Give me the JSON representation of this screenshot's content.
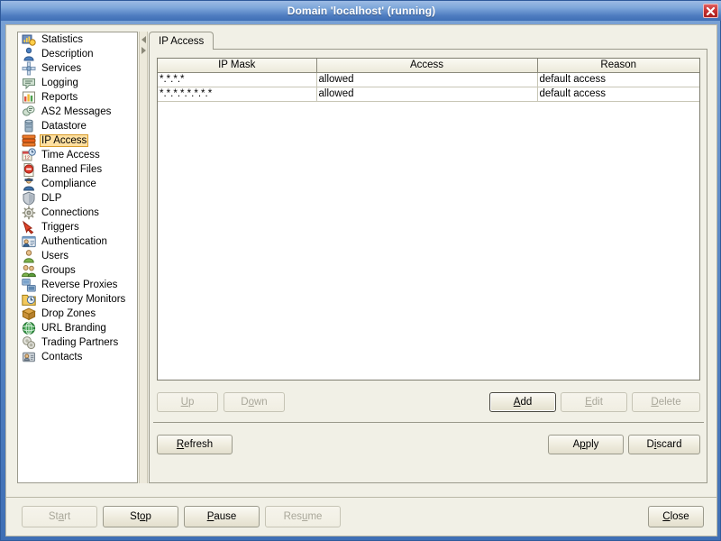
{
  "window": {
    "title": "Domain 'localhost' (running)",
    "close_icon": "close-icon"
  },
  "sidebar": {
    "items": [
      {
        "label": "Statistics",
        "icon": "statistics-icon",
        "selected": false
      },
      {
        "label": "Description",
        "icon": "description-icon",
        "selected": false
      },
      {
        "label": "Services",
        "icon": "services-icon",
        "selected": false
      },
      {
        "label": "Logging",
        "icon": "logging-icon",
        "selected": false
      },
      {
        "label": "Reports",
        "icon": "reports-icon",
        "selected": false
      },
      {
        "label": "AS2 Messages",
        "icon": "as2-messages-icon",
        "selected": false
      },
      {
        "label": "Datastore",
        "icon": "datastore-icon",
        "selected": false
      },
      {
        "label": "IP Access",
        "icon": "ip-access-icon",
        "selected": true
      },
      {
        "label": "Time Access",
        "icon": "time-access-icon",
        "selected": false
      },
      {
        "label": "Banned Files",
        "icon": "banned-files-icon",
        "selected": false
      },
      {
        "label": "Compliance",
        "icon": "compliance-icon",
        "selected": false
      },
      {
        "label": "DLP",
        "icon": "dlp-icon",
        "selected": false
      },
      {
        "label": "Connections",
        "icon": "connections-icon",
        "selected": false
      },
      {
        "label": "Triggers",
        "icon": "triggers-icon",
        "selected": false
      },
      {
        "label": "Authentication",
        "icon": "authentication-icon",
        "selected": false
      },
      {
        "label": "Users",
        "icon": "users-icon",
        "selected": false
      },
      {
        "label": "Groups",
        "icon": "groups-icon",
        "selected": false
      },
      {
        "label": "Reverse Proxies",
        "icon": "reverse-proxies-icon",
        "selected": false
      },
      {
        "label": "Directory Monitors",
        "icon": "directory-monitors-icon",
        "selected": false
      },
      {
        "label": "Drop Zones",
        "icon": "drop-zones-icon",
        "selected": false
      },
      {
        "label": "URL Branding",
        "icon": "url-branding-icon",
        "selected": false
      },
      {
        "label": "Trading Partners",
        "icon": "trading-partners-icon",
        "selected": false
      },
      {
        "label": "Contacts",
        "icon": "contacts-icon",
        "selected": false
      }
    ]
  },
  "splitter": {
    "collapse_left_icon": "triangle-left-icon",
    "collapse_right_icon": "triangle-right-icon"
  },
  "tabs": [
    {
      "label": "IP Access",
      "active": true
    }
  ],
  "table": {
    "columns": [
      "IP Mask",
      "Access",
      "Reason"
    ],
    "rows": [
      {
        "ip_mask": "*.*.*.*",
        "access": "allowed",
        "reason": "default access"
      },
      {
        "ip_mask": "*.*.*.*.*.*.*.*",
        "access": "allowed",
        "reason": "default access"
      }
    ]
  },
  "list_buttons": {
    "up": {
      "label": "Up",
      "mnemonic": "U",
      "enabled": false,
      "focused": false
    },
    "down": {
      "label": "Down",
      "mnemonic": "o",
      "enabled": false,
      "focused": false
    },
    "add": {
      "label": "Add",
      "mnemonic": "A",
      "enabled": true,
      "focused": true
    },
    "edit": {
      "label": "Edit",
      "mnemonic": "E",
      "enabled": false,
      "focused": false
    },
    "delete": {
      "label": "Delete",
      "mnemonic": "D",
      "enabled": false,
      "focused": false
    }
  },
  "form_buttons": {
    "refresh": {
      "label": "Refresh",
      "mnemonic": "R",
      "enabled": true
    },
    "apply": {
      "label": "Apply",
      "mnemonic": "p",
      "enabled": true
    },
    "discard": {
      "label": "Discard",
      "mnemonic": "i",
      "enabled": true
    }
  },
  "bottom_buttons": {
    "start": {
      "label": "Start",
      "mnemonic": "a",
      "enabled": false
    },
    "stop": {
      "label": "Stop",
      "mnemonic": "o",
      "enabled": true
    },
    "pause": {
      "label": "Pause",
      "mnemonic": "P",
      "enabled": true
    },
    "resume": {
      "label": "Resume",
      "mnemonic": "u",
      "enabled": false
    },
    "close": {
      "label": "Close",
      "mnemonic": "C",
      "enabled": true
    }
  },
  "colors": {
    "titlebar_top": "#9dbbe4",
    "titlebar_bottom": "#3f6fb5",
    "panel_background": "#f1f0e6",
    "selection_highlight": "#ffe0a0",
    "selection_border": "#d79b2a",
    "close_button": "#c53030",
    "grid_background": "#ffffff"
  }
}
